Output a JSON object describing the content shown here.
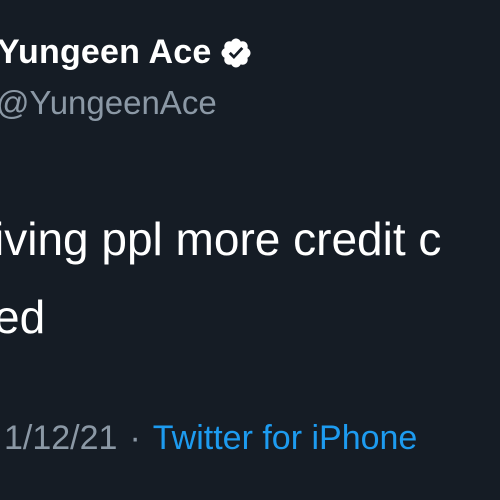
{
  "tweet": {
    "author": {
      "display_name": "Yungeen Ace",
      "handle": "@YungeenAce",
      "verified_icon": "verified-badge-icon"
    },
    "text_lines": [
      "iving ppl more credit c",
      "ed"
    ],
    "date": "1/12/21",
    "separator": "·",
    "source": "Twitter for iPhone"
  },
  "colors": {
    "background": "#151c25",
    "primary_text": "#ffffff",
    "secondary_text": "#8b98a5",
    "link": "#1d9bf0"
  }
}
